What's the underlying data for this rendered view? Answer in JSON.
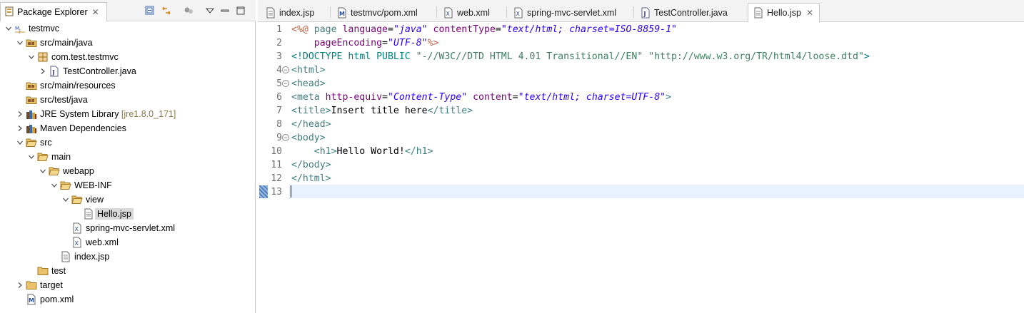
{
  "explorer": {
    "title": "Package Explorer",
    "tree": [
      {
        "label": "testmvc",
        "depth": 0,
        "expanded": true,
        "icon": "maven-project-icon"
      },
      {
        "label": "src/main/java",
        "depth": 1,
        "expanded": true,
        "icon": "source-folder-icon"
      },
      {
        "label": "com.test.testmvc",
        "depth": 2,
        "expanded": true,
        "icon": "package-icon"
      },
      {
        "label": "TestController.java",
        "depth": 3,
        "expanded": false,
        "icon": "java-file-icon"
      },
      {
        "label": "src/main/resources",
        "depth": 1,
        "expanded": null,
        "icon": "source-folder-icon"
      },
      {
        "label": "src/test/java",
        "depth": 1,
        "expanded": null,
        "icon": "source-folder-icon"
      },
      {
        "label": "JRE System Library",
        "decoration": "[jre1.8.0_171]",
        "depth": 1,
        "expanded": false,
        "icon": "library-icon"
      },
      {
        "label": "Maven Dependencies",
        "depth": 1,
        "expanded": false,
        "icon": "library-icon"
      },
      {
        "label": "src",
        "depth": 1,
        "expanded": true,
        "icon": "folder-open-icon"
      },
      {
        "label": "main",
        "depth": 2,
        "expanded": true,
        "icon": "folder-open-icon"
      },
      {
        "label": "webapp",
        "depth": 3,
        "expanded": true,
        "icon": "folder-open-icon"
      },
      {
        "label": "WEB-INF",
        "depth": 4,
        "expanded": true,
        "icon": "folder-open-icon"
      },
      {
        "label": "view",
        "depth": 5,
        "expanded": true,
        "icon": "folder-open-icon"
      },
      {
        "label": "Hello.jsp",
        "depth": 6,
        "expanded": null,
        "icon": "jsp-file-icon",
        "selected": true
      },
      {
        "label": "spring-mvc-servlet.xml",
        "depth": 5,
        "expanded": null,
        "icon": "xml-file-icon"
      },
      {
        "label": "web.xml",
        "depth": 5,
        "expanded": null,
        "icon": "xml-file-icon"
      },
      {
        "label": "index.jsp",
        "depth": 4,
        "expanded": null,
        "icon": "jsp-file-icon"
      },
      {
        "label": "test",
        "depth": 2,
        "expanded": null,
        "icon": "folder-icon"
      },
      {
        "label": "target",
        "depth": 1,
        "expanded": false,
        "icon": "folder-icon"
      },
      {
        "label": "pom.xml",
        "depth": 1,
        "expanded": null,
        "icon": "maven-pom-icon"
      }
    ]
  },
  "editor": {
    "tabs": [
      {
        "label": "index.jsp",
        "icon": "jsp-file-icon",
        "active": false
      },
      {
        "label": "testmvc/pom.xml",
        "icon": "maven-pom-icon",
        "active": false
      },
      {
        "label": "web.xml",
        "icon": "xml-file-icon",
        "active": false
      },
      {
        "label": "spring-mvc-servlet.xml",
        "icon": "xml-file-icon",
        "active": false
      },
      {
        "label": "TestController.java",
        "icon": "java-file-icon",
        "active": false
      },
      {
        "label": "Hello.jsp",
        "icon": "jsp-file-icon",
        "active": true
      }
    ],
    "current_line": 13,
    "lines": [
      {
        "n": "1",
        "fold": false,
        "tokens": [
          [
            "t-jsp",
            "<%@ "
          ],
          [
            "t-tag",
            "page "
          ],
          [
            "t-attr",
            "language"
          ],
          [
            "t-plain",
            "="
          ],
          [
            "t-val",
            "\"java\""
          ],
          [
            "t-plain",
            " "
          ],
          [
            "t-attr",
            "contentType"
          ],
          [
            "t-plain",
            "="
          ],
          [
            "t-val",
            "\"text/html; charset=ISO-8859-1\""
          ]
        ]
      },
      {
        "n": "2",
        "fold": false,
        "tokens": [
          [
            "t-plain",
            "    "
          ],
          [
            "t-attr",
            "pageEncoding"
          ],
          [
            "t-plain",
            "="
          ],
          [
            "t-val",
            "\"UTF-8\""
          ],
          [
            "t-jsp",
            "%>"
          ]
        ]
      },
      {
        "n": "3",
        "fold": false,
        "tokens": [
          [
            "t-doc",
            "<!DOCTYPE html PUBLIC "
          ],
          [
            "t-str",
            "\"-//W3C//DTD HTML 4.01 Transitional//EN\""
          ],
          [
            "t-plain",
            " "
          ],
          [
            "t-str",
            "\"http://www.w3.org/TR/html4/loose.dtd\""
          ],
          [
            "t-doc",
            ">"
          ]
        ]
      },
      {
        "n": "4",
        "fold": true,
        "tokens": [
          [
            "t-tag",
            "<html>"
          ]
        ]
      },
      {
        "n": "5",
        "fold": true,
        "tokens": [
          [
            "t-tag",
            "<head>"
          ]
        ]
      },
      {
        "n": "6",
        "fold": false,
        "tokens": [
          [
            "t-tag",
            "<meta "
          ],
          [
            "t-attr",
            "http-equiv"
          ],
          [
            "t-plain",
            "="
          ],
          [
            "t-val",
            "\"Content-Type\""
          ],
          [
            "t-plain",
            " "
          ],
          [
            "t-attr",
            "content"
          ],
          [
            "t-plain",
            "="
          ],
          [
            "t-val",
            "\"text/html; charset=UTF-8\""
          ],
          [
            "t-tag",
            ">"
          ]
        ]
      },
      {
        "n": "7",
        "fold": false,
        "tokens": [
          [
            "t-tag",
            "<title>"
          ],
          [
            "t-plain",
            "Insert title here"
          ],
          [
            "t-tag",
            "</title>"
          ]
        ]
      },
      {
        "n": "8",
        "fold": false,
        "tokens": [
          [
            "t-tag",
            "</head>"
          ]
        ]
      },
      {
        "n": "9",
        "fold": true,
        "tokens": [
          [
            "t-tag",
            "<body>"
          ]
        ]
      },
      {
        "n": "10",
        "fold": false,
        "tokens": [
          [
            "t-plain",
            "    "
          ],
          [
            "t-tag",
            "<h1>"
          ],
          [
            "t-plain",
            "Hello World!"
          ],
          [
            "t-tag",
            "</h1>"
          ]
        ]
      },
      {
        "n": "11",
        "fold": false,
        "tokens": [
          [
            "t-tag",
            "</body>"
          ]
        ]
      },
      {
        "n": "12",
        "fold": false,
        "tokens": [
          [
            "t-tag",
            "</html>"
          ]
        ]
      },
      {
        "n": "13",
        "fold": false,
        "tokens": []
      }
    ]
  },
  "colors": {
    "tag": "#3f7f7f",
    "attribute": "#7f007f",
    "attribute_value": "#2a00ff",
    "jsp_delimiter": "#bf5f3f",
    "current_line_bg": "#e8f2fe",
    "selection_bg": "#d9d9d9"
  }
}
